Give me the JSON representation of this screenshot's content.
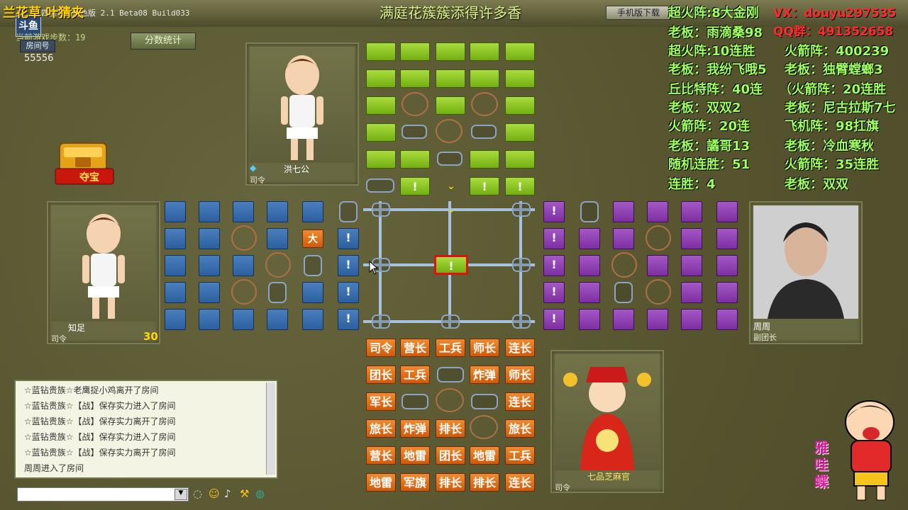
{
  "window": {
    "title": "满庭花簇簇添得许多香",
    "game_title": "四国军棋角色版 2.1 Beta08 Build033",
    "overlay_name": "兰花草 叶猜夹",
    "logo": "斗鱼",
    "mobile_btn": "手机版下载"
  },
  "room": {
    "steps_label": "当前游戏步数：19",
    "room_btn": "房间号",
    "room_no": "55556",
    "score_btn": "分数统计",
    "treasure_label": "夺宝"
  },
  "players": {
    "top": {
      "name": "洪七公",
      "rank": "司令"
    },
    "left": {
      "name": "知足",
      "rank": "司令",
      "timer": "30"
    },
    "right": {
      "name": "周周",
      "rank": "副团长"
    },
    "bottom": {
      "name": "七品芝麻官",
      "rank": "司令"
    }
  },
  "board": {
    "center_piece": "!",
    "top_marks": [
      "!",
      "⌄",
      "!",
      "!"
    ],
    "top_mark2": "⌄",
    "left_pieces": [
      "大",
      "!",
      "!",
      "!",
      "!"
    ],
    "right_pieces": [
      "!",
      "!",
      "!",
      "!",
      "!"
    ],
    "bottom": [
      [
        "司令",
        "营长",
        "工兵",
        "师长",
        "连长"
      ],
      [
        "团长",
        "工兵",
        "",
        "炸弹",
        "师长"
      ],
      [
        "军长",
        "",
        "",
        "",
        "连长"
      ],
      [
        "旅长",
        "炸弹",
        "排长",
        "",
        "旅长"
      ],
      [
        "营长",
        "地雷",
        "团长",
        "地雷",
        "工兵"
      ],
      [
        "地雷",
        "军旗",
        "排长",
        "排长",
        "连长"
      ]
    ]
  },
  "chat": {
    "lines": [
      "☆蓝钻贵族☆老鹰捉小鸡离开了房间",
      "☆蓝钻贵族☆【战】保存实力进入了房间",
      "☆蓝钻贵族☆【战】保存实力离开了房间",
      "☆蓝钻贵族☆【战】保存实力进入了房间",
      "☆蓝钻贵族☆【战】保存实力离开了房间",
      "周周进入了房间"
    ]
  },
  "overlay": {
    "vx": "VX：douyu297535",
    "qq": "QQ群：491352658",
    "records_left": [
      "超火阵:8大金刚",
      "老板：雨滴桑98",
      "超火阵:10连胜",
      "老板：我纷飞哦5",
      "丘比特阵：40连",
      "老板：双双2",
      "火箭阵：20连",
      "老板：譎哥13",
      "随机连胜：51",
      "连胜：4"
    ],
    "records_right": [
      "火箭阵：400239",
      "老板：独臂螳螂3",
      "（火箭阵：20连胜",
      "老板：尼古拉斯7七",
      "飞机阵：98扛旗",
      "老板：冷血寒秋",
      "火箭阵：35连胜",
      "老板：双双"
    ],
    "sticker_text": "雅哇蝶"
  }
}
